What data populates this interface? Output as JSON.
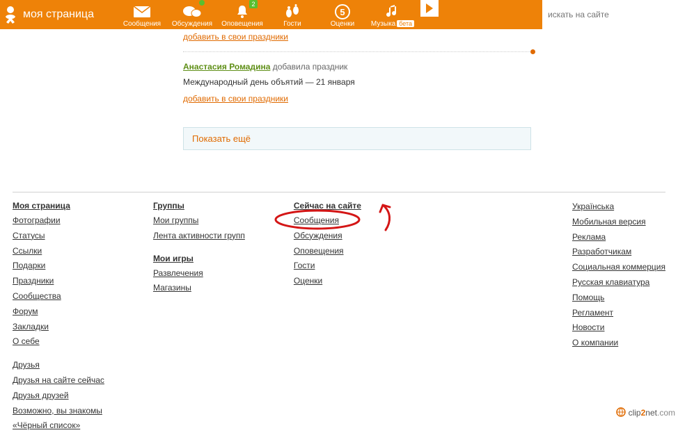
{
  "header": {
    "page_title": "моя страница",
    "nav": [
      {
        "label": "Сообщения",
        "icon": "envelope"
      },
      {
        "label": "Обсуждения",
        "icon": "bubbles",
        "badge": ""
      },
      {
        "label": "Оповещения",
        "icon": "bell",
        "badge": "2"
      },
      {
        "label": "Гости",
        "icon": "feet"
      },
      {
        "label": "Оценки",
        "icon": "five"
      },
      {
        "label": "Музыка",
        "icon": "note",
        "beta": "бета"
      }
    ],
    "search_placeholder": "искать на сайте"
  },
  "feed": {
    "add_link_top": "добавить в свои праздники",
    "user_name": "Анастасия Ромадина",
    "user_action": "добавила праздник",
    "holiday_text": "Международный день объятий — 21 января",
    "add_link": "добавить в свои праздники",
    "show_more": "Показать ещё"
  },
  "footer": {
    "col1": {
      "header": "Моя страница",
      "links": [
        "Фотографии",
        "Статусы",
        "Ссылки",
        "Подарки",
        "Праздники",
        "Сообщества",
        "Форум",
        "Закладки",
        "О себе"
      ],
      "links2": [
        "Друзья",
        "Друзья на сайте сейчас",
        "Друзья друзей",
        "Возможно, вы знакомы",
        "«Чёрный список»"
      ]
    },
    "col2": {
      "header": "Группы",
      "links": [
        "Мои группы",
        "Лента активности групп"
      ],
      "header2": "Мои игры",
      "links2": [
        "Развлечения",
        "Магазины"
      ]
    },
    "col3": {
      "header": "Сейчас на сайте",
      "links": [
        "Сообщения",
        "Обсуждения",
        "Оповещения",
        "Гости",
        "Оценки"
      ]
    },
    "col4": {
      "links": [
        "Українська",
        "Мобильная версия",
        "Реклама",
        "Разработчикам",
        "Социальная коммерция",
        "Русская клавиатура",
        "Помощь",
        "Регламент",
        "Новости",
        "О компании"
      ]
    }
  },
  "watermark": {
    "t1": "clip",
    "t2": "2",
    "t3": "net",
    "t4": ".com"
  }
}
